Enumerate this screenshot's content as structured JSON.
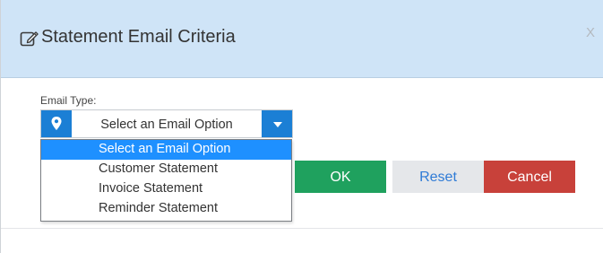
{
  "dialog": {
    "title": "Statement Email Criteria",
    "close_label": "X",
    "title_icon": "edit-icon"
  },
  "form": {
    "email_type_label": "Email Type:",
    "email_type_value": "Select an Email Option",
    "addon_icon": "map-marker-icon",
    "caret_icon": "caret-down-icon",
    "options": [
      "Select an Email Option",
      "Customer Statement",
      "Invoice Statement",
      "Reminder Statement"
    ],
    "selected_index": 0
  },
  "buttons": {
    "ok_label": "OK",
    "reset_label": "Reset",
    "cancel_label": "Cancel"
  },
  "colors": {
    "header_bg": "#cfe4f7",
    "accent": "#1b7fd5",
    "selected_option": "#1e90ff",
    "ok": "#1fa15e",
    "cancel": "#c8413a",
    "reset_text": "#2f7bd6"
  }
}
